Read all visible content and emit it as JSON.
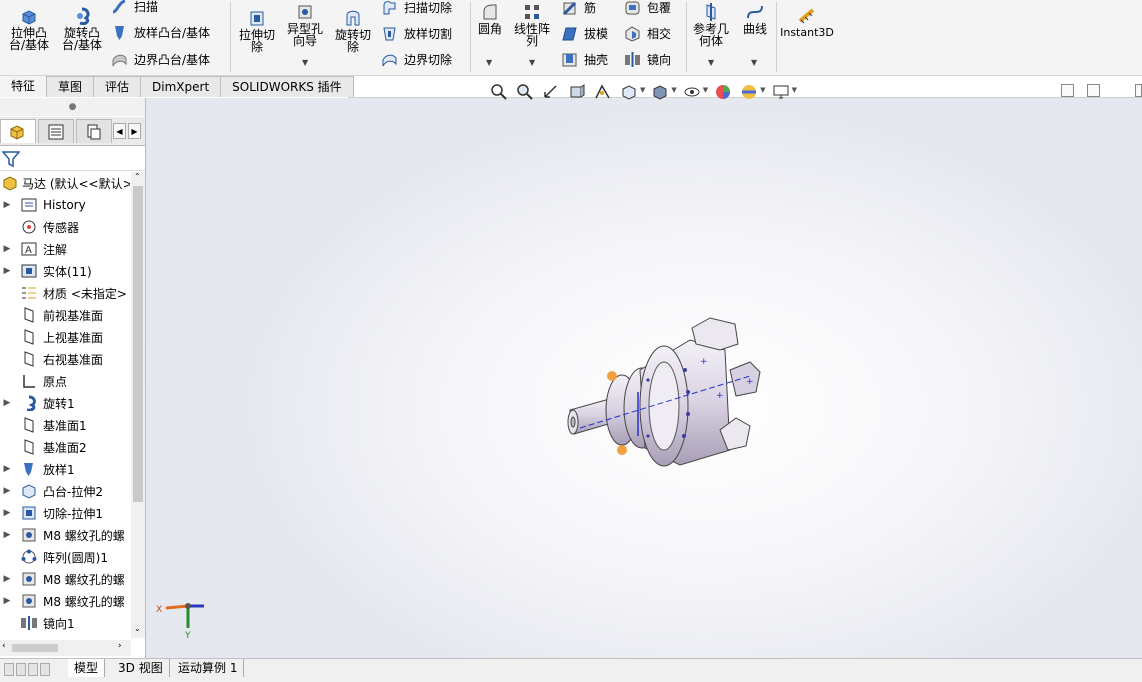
{
  "ribbon": {
    "extrude_boss": "拉伸凸台/基体",
    "revolve_boss": "旋转凸台/基体",
    "sweep": "扫描",
    "loft_boss": "放样凸台/基体",
    "boundary_boss": "边界凸台/基体",
    "extrude_cut": "拉伸切除",
    "hole_wizard": "异型孔向导",
    "revolve_cut": "旋转切除",
    "swept_cut": "扫描切除",
    "lofted_cut": "放样切割",
    "boundary_cut": "边界切除",
    "fillet": "圆角",
    "linear_pattern": "线性阵列",
    "rib": "筋",
    "draft": "拔模",
    "shell": "抽壳",
    "wrap": "包覆",
    "intersect": "相交",
    "mirror": "镜向",
    "ref_geometry": "参考几何体",
    "curves": "曲线",
    "instant3d": "Instant3D"
  },
  "command_tabs": [
    "特征",
    "草图",
    "评估",
    "DimXpert",
    "SOLIDWORKS 插件"
  ],
  "tree": {
    "root": "马达  (默认<<默认>",
    "items": [
      {
        "label": "History",
        "expand": true
      },
      {
        "label": "传感器",
        "expand": false
      },
      {
        "label": "注解",
        "expand": true
      },
      {
        "label": "实体(11)",
        "expand": true
      },
      {
        "label": "材质 <未指定>",
        "expand": false
      },
      {
        "label": "前视基准面",
        "expand": false
      },
      {
        "label": "上视基准面",
        "expand": false
      },
      {
        "label": "右视基准面",
        "expand": false
      },
      {
        "label": "原点",
        "expand": false
      },
      {
        "label": "旋转1",
        "expand": true
      },
      {
        "label": "基准面1",
        "expand": false
      },
      {
        "label": "基准面2",
        "expand": false
      },
      {
        "label": "放样1",
        "expand": true
      },
      {
        "label": "凸台-拉伸2",
        "expand": true
      },
      {
        "label": "切除-拉伸1",
        "expand": true
      },
      {
        "label": "M8 螺纹孔的螺",
        "expand": true
      },
      {
        "label": "阵列(圆周)1",
        "expand": false
      },
      {
        "label": "M8 螺纹孔的螺",
        "expand": true
      },
      {
        "label": "M8 螺纹孔的螺",
        "expand": true
      },
      {
        "label": "镜向1",
        "expand": false
      }
    ]
  },
  "triad": {
    "x": "X",
    "y": "Y"
  },
  "bottom_tabs": [
    "模型",
    "3D 视图",
    "运动算例 1"
  ]
}
